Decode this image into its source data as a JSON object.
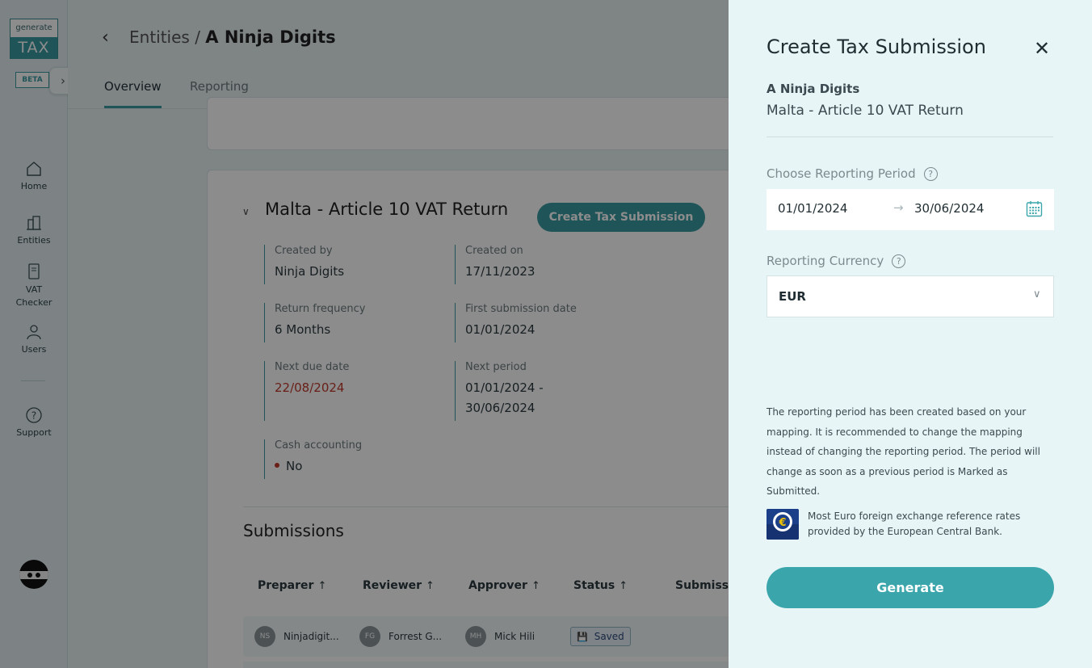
{
  "sidebar": {
    "logo_top": "generate",
    "logo_bottom": "TAX",
    "beta": "BETA",
    "expand_icon": "chevron-right-icon",
    "nav": [
      {
        "label": "Home",
        "icon": "home-icon"
      },
      {
        "label": "Entities",
        "icon": "building-icon"
      },
      {
        "label": "VAT Checker",
        "icon": "document-icon"
      },
      {
        "label": "Users",
        "icon": "user-icon"
      },
      {
        "label": "Support",
        "icon": "help-icon"
      }
    ]
  },
  "header": {
    "back_icon": "chevron-left-icon",
    "breadcrumb_parent": "Entities /",
    "breadcrumb_current": "A Ninja Digits",
    "tabs": [
      {
        "label": "Overview",
        "active": true
      },
      {
        "label": "Reporting",
        "active": false
      }
    ]
  },
  "return_card": {
    "title": "Malta - Article 10 VAT Return",
    "create_button": "Create Tax Submission",
    "fields": {
      "created_by_label": "Created by",
      "created_by_value": "Ninja Digits",
      "created_on_label": "Created on",
      "created_on_value": "17/11/2023",
      "return_frequency_label": "Return frequency",
      "return_frequency_value": "6 Months",
      "first_submission_label": "First submission date",
      "first_submission_value": "01/01/2024",
      "next_due_label": "Next due date",
      "next_due_value": "22/08/2024",
      "next_period_label": "Next period",
      "next_period_line1": "01/01/2024 -",
      "next_period_line2": "30/06/2024",
      "cash_accounting_label": "Cash accounting",
      "cash_accounting_value": "No"
    }
  },
  "submissions": {
    "title": "Submissions",
    "columns": [
      "Preparer",
      "Reviewer",
      "Approver",
      "Status",
      "Submissi"
    ],
    "rows": [
      {
        "preparer_initials": "NS",
        "preparer": "Ninjadigit...",
        "reviewer_initials": "FG",
        "reviewer": "Forrest G...",
        "approver_initials": "MH",
        "approver": "Mick Hili",
        "status": "Saved"
      }
    ]
  },
  "drawer": {
    "title": "Create Tax Submission",
    "close_icon": "close-icon",
    "entity": "A Ninja Digits",
    "return_name": "Malta - Article 10 VAT Return",
    "period_label": "Choose Reporting Period",
    "period_from": "01/01/2024",
    "period_to": "30/06/2024",
    "period_arrow": "→",
    "currency_label": "Reporting Currency",
    "currency_value": "EUR",
    "note": "The reporting period has been created based on your mapping. It is recommended to change the mapping instead of changing the reporting period. The period will change as soon as a previous period is Marked as Submitted.",
    "ecb_text": "Most Euro foreign exchange reference rates provided by the European Central Bank.",
    "generate_button": "Generate",
    "accent": "#3aa6ab"
  }
}
